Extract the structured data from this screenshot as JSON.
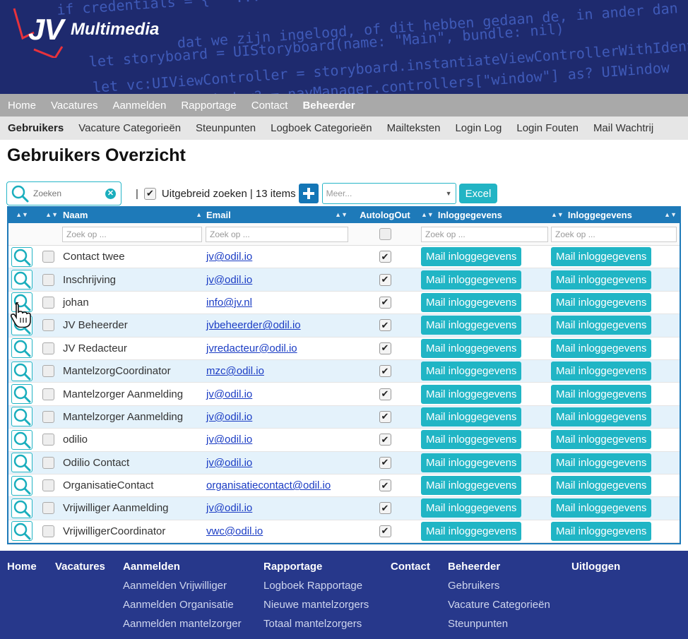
{
  "header": {
    "logo_jv": "JV",
    "logo_text": "Multimedia",
    "code_lines": [
      "if credentials = { \" ...",
      "dat we zijn ingelogd, of dit hebben gedaan de, in ander dan",
      "let storyboard = UIStoryboard(name: \"Main\", bundle: nil)",
      "let vc:UIViewController = storyboard.instantiateViewControllerWithIdentifier",
      "let window:UIWindow? = navManager.controllers[\"window\"] as? UIWindow"
    ]
  },
  "topnav": {
    "items": [
      "Home",
      "Vacatures",
      "Aanmelden",
      "Rapportage",
      "Contact",
      "Beheerder"
    ],
    "active": "Beheerder"
  },
  "subnav": {
    "items": [
      "Gebruikers",
      "Vacature Categorieën",
      "Steunpunten",
      "Logboek Categorieën",
      "Mailteksten",
      "Login Log",
      "Login Fouten",
      "Mail Wachtrij"
    ],
    "active": "Gebruikers"
  },
  "page": {
    "title": "Gebruikers Overzicht"
  },
  "toolbar": {
    "search_placeholder": "Zoeken",
    "separator": "|",
    "extended_search_label": "Uitgebreid zoeken",
    "items_count": "| 13 items",
    "more_placeholder": "Meer...",
    "excel_label": "Excel"
  },
  "grid": {
    "columns": [
      "Naam",
      "Email",
      "AutologOut",
      "Inloggegevens",
      "Inloggegevens"
    ],
    "filter_placeholder": "Zoek op ...",
    "button_label": "Mail inloggegevens",
    "rows": [
      {
        "name": "Contact twee",
        "email": "jv@odil.io",
        "autologout": true
      },
      {
        "name": "Inschrijving",
        "email": "jv@odil.io",
        "autologout": true
      },
      {
        "name": "johan",
        "email": "info@jv.nl",
        "autologout": true
      },
      {
        "name": "JV Beheerder",
        "email": "jvbeheerder@odil.io",
        "autologout": true
      },
      {
        "name": "JV Redacteur",
        "email": "jvredacteur@odil.io",
        "autologout": true
      },
      {
        "name": "MantelzorgCoordinator",
        "email": "mzc@odil.io",
        "autologout": true
      },
      {
        "name": "Mantelzorger Aanmelding",
        "email": "jv@odil.io",
        "autologout": true
      },
      {
        "name": "Mantelzorger Aanmelding",
        "email": "jv@odil.io",
        "autologout": true
      },
      {
        "name": "odilio",
        "email": "jv@odil.io",
        "autologout": true
      },
      {
        "name": "Odilio Contact",
        "email": "jv@odil.io",
        "autologout": true
      },
      {
        "name": "OrganisatieContact",
        "email": "organisatiecontact@odil.io",
        "autologout": true
      },
      {
        "name": "Vrijwilliger Aanmelding",
        "email": "jv@odil.io",
        "autologout": true
      },
      {
        "name": "VrijwilligerCoordinator",
        "email": "vwc@odil.io",
        "autologout": true
      }
    ]
  },
  "footer": {
    "columns": [
      {
        "heading": "Home",
        "links": []
      },
      {
        "heading": "Vacatures",
        "links": []
      },
      {
        "heading": "Aanmelden",
        "links": [
          "Aanmelden Vrijwilliger",
          "Aanmelden Organisatie",
          "Aanmelden mantelzorger"
        ]
      },
      {
        "heading": "Rapportage",
        "links": [
          "Logboek Rapportage",
          "Nieuwe mantelzorgers",
          "Totaal mantelzorgers"
        ]
      },
      {
        "heading": "Contact",
        "links": []
      },
      {
        "heading": "Beheerder",
        "links": [
          "Gebruikers",
          "Vacature Categorieën",
          "Steunpunten"
        ]
      },
      {
        "heading": "Uitloggen",
        "links": []
      }
    ]
  },
  "colors": {
    "header_bg": "#1e2a6e",
    "topnav_bg": "#a9a9a9",
    "grid_header": "#1e7ab9",
    "accent": "#20b5c5",
    "row_alt": "#e4f2fb",
    "footer_bg": "#27388b"
  }
}
